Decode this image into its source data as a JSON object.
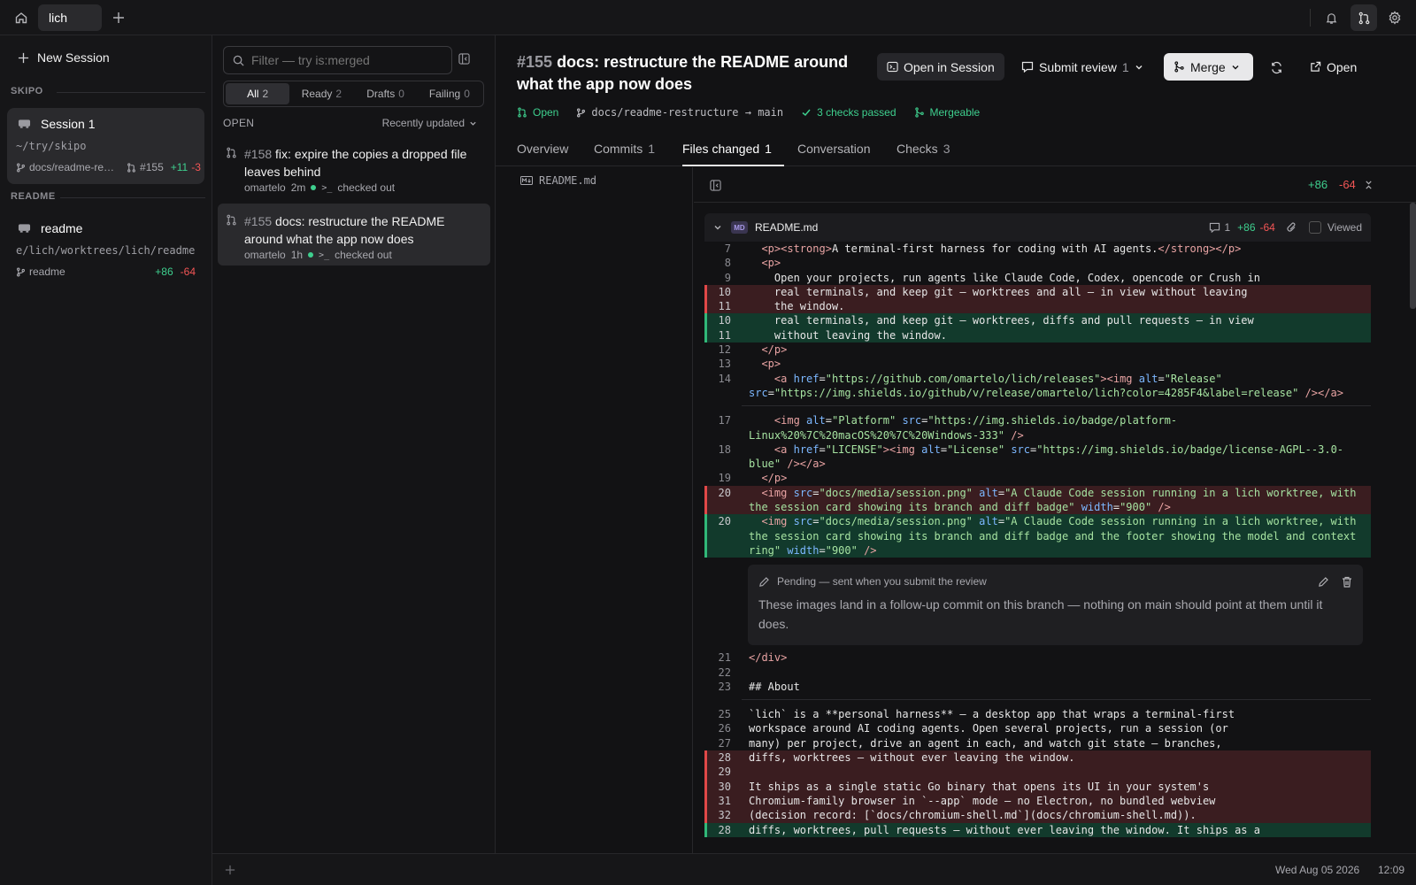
{
  "topbar": {
    "tab_label": "lich",
    "icons": [
      "home-icon",
      "plus-icon",
      "bell-icon",
      "git-pull-request-icon",
      "gear-icon"
    ]
  },
  "sidebar": {
    "new_session": "New Session",
    "groups": [
      {
        "label": "SKIPO",
        "session": {
          "title": "Session 1",
          "path": "~/try/skipo",
          "branch": "docs/readme-re…",
          "pr": "#155",
          "added": "+11",
          "removed": "-3"
        }
      },
      {
        "label": "README",
        "session": {
          "title": "readme",
          "path": "e/lich/worktrees/lich/readme",
          "branch": "readme",
          "added": "+86",
          "removed": "-64"
        }
      }
    ]
  },
  "pr_list": {
    "filter_placeholder": "Filter — try is:merged",
    "segments": [
      {
        "label": "All",
        "count": "2"
      },
      {
        "label": "Ready",
        "count": "2"
      },
      {
        "label": "Drafts",
        "count": "0"
      },
      {
        "label": "Failing",
        "count": "0"
      }
    ],
    "section": "OPEN",
    "sort": "Recently updated",
    "items": [
      {
        "number": "#158",
        "title": "fix: expire the copies a dropped file leaves behind",
        "author": "omartelo",
        "age": "2m",
        "state": "checked out"
      },
      {
        "number": "#155",
        "title": "docs: restructure the README around what the app now does",
        "author": "omartelo",
        "age": "1h",
        "state": "checked out"
      }
    ]
  },
  "pr": {
    "number": "#155",
    "title": "docs: restructure the README around what the app now does",
    "actions": {
      "open_in_session": "Open in Session",
      "submit_review": "Submit review",
      "submit_count": "1",
      "merge": "Merge",
      "open": "Open"
    },
    "status": {
      "state": "Open",
      "branches": "docs/readme-restructure → main",
      "checks": "3 checks passed",
      "mergeable": "Mergeable"
    },
    "tabs": [
      {
        "label": "Overview",
        "count": ""
      },
      {
        "label": "Commits",
        "count": "1"
      },
      {
        "label": "Files changed",
        "count": "1"
      },
      {
        "label": "Conversation",
        "count": ""
      },
      {
        "label": "Checks",
        "count": "3"
      }
    ],
    "file_tree": [
      "README.md"
    ],
    "diff_totals": {
      "added": "+86",
      "removed": "-64"
    },
    "file": {
      "name": "README.md",
      "comments": "1",
      "added": "+86",
      "removed": "-64",
      "viewed_label": "Viewed"
    },
    "comment": {
      "status": "Pending — sent when you submit the review",
      "body": "These images land in a follow-up commit on this branch — nothing on main should point at them until it does."
    }
  },
  "footer": {
    "date": "Wed Aug 05 2026",
    "time": "12:09"
  },
  "colors": {
    "added": "#3ecf8e",
    "removed": "#f25555",
    "accent_bg": "#2a2a2d"
  }
}
